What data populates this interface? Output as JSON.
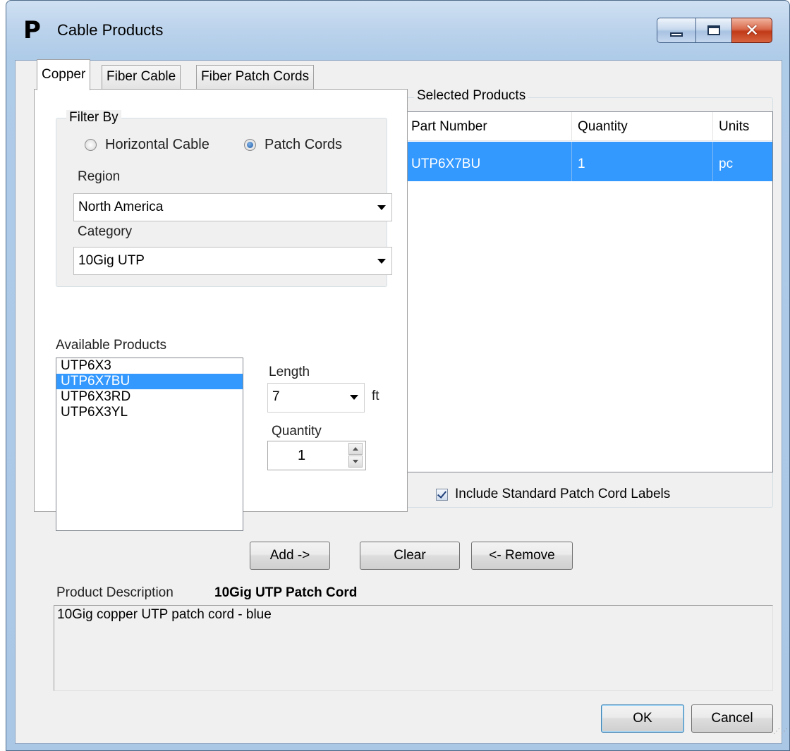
{
  "window": {
    "title": "Cable Products",
    "logo": "P",
    "controls": {
      "minimize": "minimize-icon",
      "maximize": "maximize-icon",
      "close": "close-icon"
    }
  },
  "tabs": [
    {
      "label": "Copper",
      "active": true
    },
    {
      "label": "Fiber Cable",
      "active": false
    },
    {
      "label": "Fiber Patch Cords",
      "active": false
    }
  ],
  "filter": {
    "label": "Filter By",
    "options": [
      {
        "label": "Horizontal Cable",
        "checked": false
      },
      {
        "label": "Patch Cords",
        "checked": true
      }
    ],
    "region_label": "Region",
    "region_value": "North America",
    "category_label": "Category",
    "category_value": "10Gig UTP"
  },
  "available": {
    "label": "Available Products",
    "items": [
      "UTP6X3",
      "UTP6X7BU",
      "UTP6X3RD",
      "UTP6X3YL"
    ],
    "selected_index": 1
  },
  "length": {
    "label": "Length",
    "value": "7",
    "unit": "ft"
  },
  "quantity": {
    "label": "Quantity",
    "value": "1"
  },
  "selected": {
    "label": "Selected Products",
    "columns": [
      "Part Number",
      "Quantity",
      "Units"
    ],
    "rows": [
      {
        "part": "UTP6X7BU",
        "qty": "1",
        "units": "pc"
      }
    ],
    "include_labels": "Include Standard Patch Cord Labels",
    "include_labels_checked": true
  },
  "buttons": {
    "add": "Add ->",
    "clear": "Clear",
    "remove": "<- Remove",
    "ok": "OK",
    "cancel": "Cancel"
  },
  "description": {
    "label": "Product Description",
    "title": "10Gig UTP Patch Cord",
    "text": "10Gig copper UTP patch cord - blue"
  },
  "colors": {
    "selection": "#3399ff",
    "title_bar": "#bcd3ec",
    "close_button": "#c03a17"
  }
}
